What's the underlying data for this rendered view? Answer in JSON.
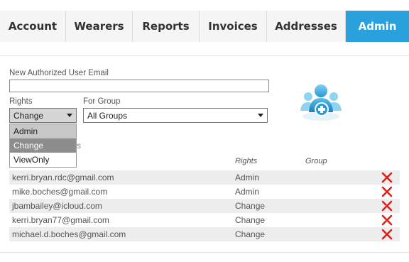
{
  "tabs": [
    {
      "label": "Account",
      "active": false
    },
    {
      "label": "Wearers",
      "active": false
    },
    {
      "label": "Reports",
      "active": false
    },
    {
      "label": "Invoices",
      "active": false
    },
    {
      "label": "Addresses",
      "active": false
    },
    {
      "label": "Admin",
      "active": true
    }
  ],
  "form": {
    "email_label": "New Authorized User Email",
    "email_value": "",
    "rights_label": "Rights",
    "rights_selected": "Change",
    "group_label": "For Group",
    "group_selected": "All Groups",
    "rights_options": [
      {
        "label": "Admin",
        "state": "normal"
      },
      {
        "label": "Change",
        "state": "highlighted"
      },
      {
        "label": "ViewOnly",
        "state": "normal"
      }
    ],
    "partial_label": "s"
  },
  "table": {
    "headers": {
      "rights": "Rights",
      "group": "Group"
    },
    "rows": [
      {
        "email": "kerri.bryan.rdc@gmail.com",
        "rights": "Admin",
        "group": ""
      },
      {
        "email": "mike.boches@gmail.com",
        "rights": "Admin",
        "group": ""
      },
      {
        "email": "jbambailey@icloud.com",
        "rights": "Change",
        "group": ""
      },
      {
        "email": "kerri.bryan77@gmail.com",
        "rights": "Change",
        "group": ""
      },
      {
        "email": "michael.d.boches@gmail.com",
        "rights": "Change",
        "group": ""
      }
    ]
  },
  "icons": {
    "delete": "delete-x-icon",
    "logo": "user-add-logo-icon"
  },
  "colors": {
    "accent": "#2aa1dc",
    "delete": "#e0201b"
  }
}
